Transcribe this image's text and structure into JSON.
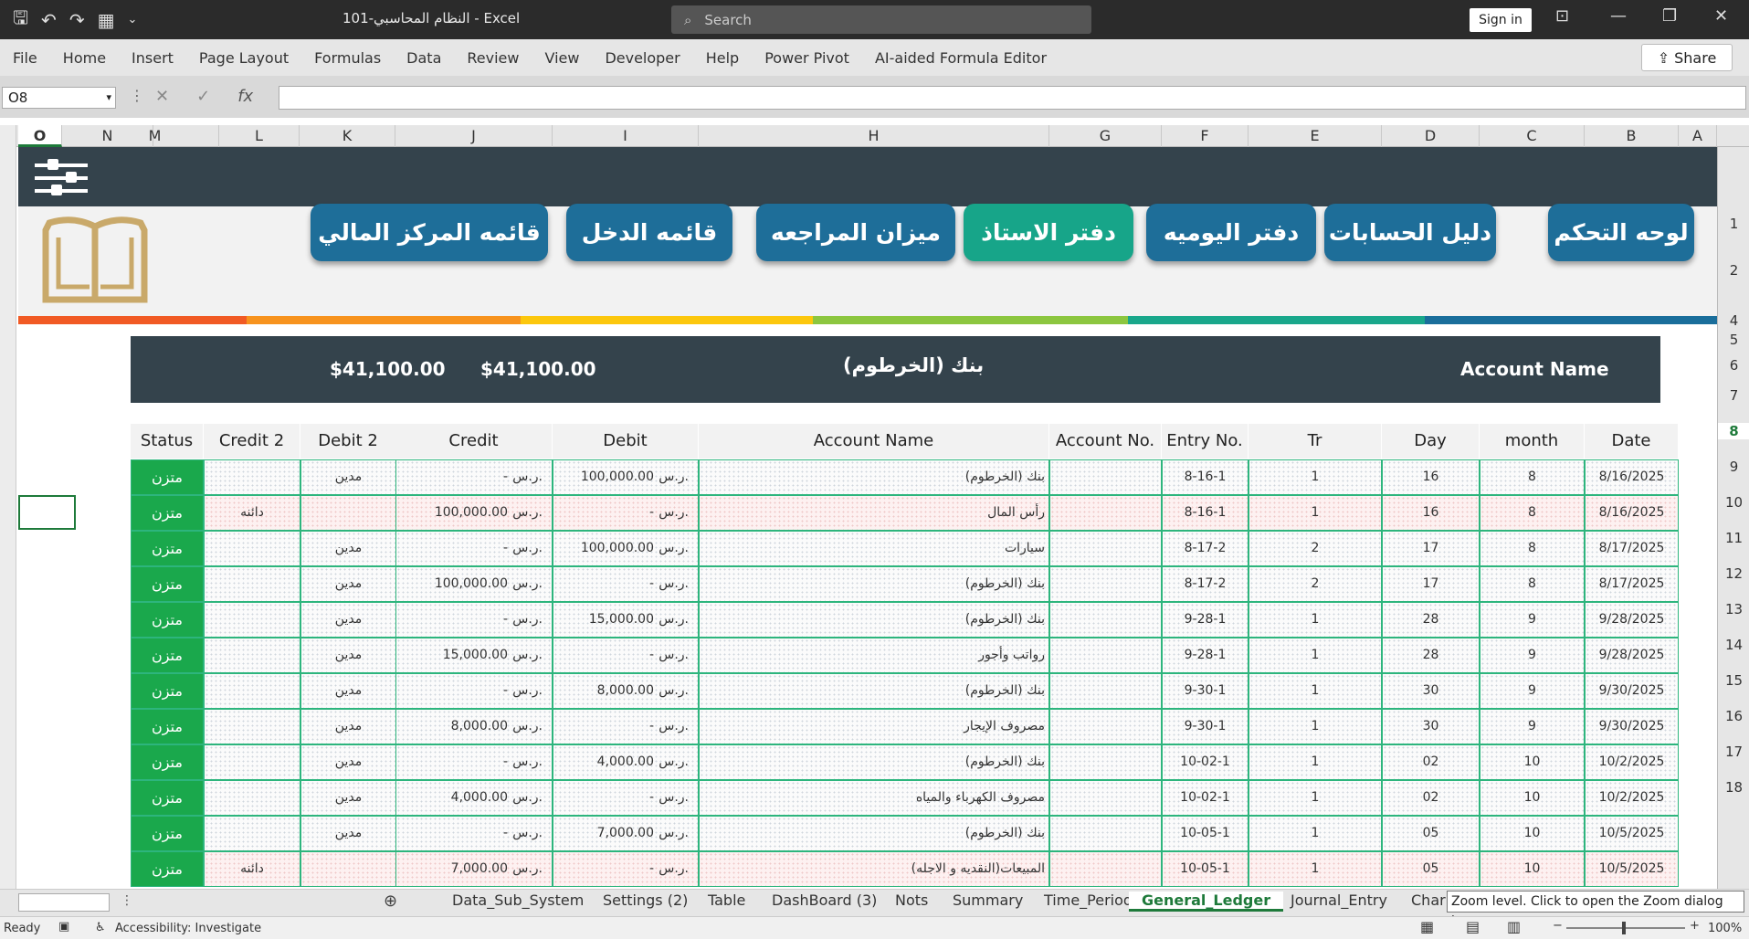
{
  "window": {
    "title": "النظام المحاسبي-101  -  Excel",
    "search_placeholder": "Search",
    "signin": "Sign in",
    "share": "Share"
  },
  "quick_access": {
    "icons": [
      "save-icon",
      "undo-icon",
      "redo-icon",
      "form-icon",
      "customize-icon"
    ]
  },
  "menu": [
    "File",
    "Home",
    "Insert",
    "Page Layout",
    "Formulas",
    "Data",
    "Review",
    "View",
    "Developer",
    "Help",
    "Power Pivot",
    "AI-aided Formula Editor"
  ],
  "formula_bar": {
    "name_box": "O8",
    "fx": "fx",
    "formula": ""
  },
  "columns": [
    "O",
    "N",
    "M",
    "L",
    "K",
    "J",
    "I",
    "H",
    "G",
    "F",
    "E",
    "D",
    "C",
    "B",
    "A"
  ],
  "row_headers": [
    "1",
    "2",
    "4",
    "5",
    "6",
    "7",
    "8",
    "9",
    "10",
    "11",
    "12",
    "13",
    "14",
    "15",
    "16",
    "17",
    "18"
  ],
  "nav_buttons": [
    {
      "label": "لوحه التحكم",
      "active": false
    },
    {
      "label": "دليل الحسابات",
      "active": false
    },
    {
      "label": "دفتر اليوميه",
      "active": false
    },
    {
      "label": "دفتر الاستاذ",
      "active": true
    },
    {
      "label": "ميزان المراجعه",
      "active": false
    },
    {
      "label": "قائمه الدخل",
      "active": false
    },
    {
      "label": "قائمه المركز المالي",
      "active": false
    }
  ],
  "stripe_colors": [
    "#f15a24",
    "#f7931e",
    "#fcc70d",
    "#8cc63f",
    "#19a78b",
    "#1a6e9b",
    "#1581c5"
  ],
  "account": {
    "label": "Account Name",
    "name": "بنك (الخرطوم)",
    "debit_total": "$41,100.00",
    "credit_total": "$41,100.00"
  },
  "table": {
    "headers": [
      "Status",
      "Credit 2",
      "Debit 2",
      "Credit",
      "Debit",
      "Account Name",
      "Account No.",
      "Entry No.",
      "Tr",
      "Day",
      "month",
      "Date"
    ],
    "rows": [
      {
        "status": "متزن",
        "credit2": "",
        "debit2": "مدين",
        "credit": "-",
        "debit": "100,000.00",
        "account": "بنك (الخرطوم)",
        "acc_no": "",
        "entry": "8-16-1",
        "tr": "1",
        "day": "16",
        "month": "8",
        "date": "8/16/2025",
        "pink": false,
        "idx": "1"
      },
      {
        "status": "متزن",
        "credit2": "دائنه",
        "debit2": "",
        "credit": "100,000.00",
        "debit": "-",
        "account": "رأس المال",
        "acc_no": "",
        "entry": "8-16-1",
        "tr": "1",
        "day": "16",
        "month": "8",
        "date": "8/16/2025",
        "pink": true,
        "idx": "2"
      },
      {
        "status": "متزن",
        "credit2": "",
        "debit2": "مدين",
        "credit": "-",
        "debit": "100,000.00",
        "account": "سيارات",
        "acc_no": "",
        "entry": "8-17-2",
        "tr": "2",
        "day": "17",
        "month": "8",
        "date": "8/17/2025",
        "pink": false,
        "idx": "3"
      },
      {
        "status": "متزن",
        "credit2": "",
        "debit2": "مدين",
        "credit": "100,000.00",
        "debit": "-",
        "account": "بنك (الخرطوم)",
        "acc_no": "",
        "entry": "8-17-2",
        "tr": "2",
        "day": "17",
        "month": "8",
        "date": "8/17/2025",
        "pink": false,
        "idx": "4"
      },
      {
        "status": "متزن",
        "credit2": "",
        "debit2": "مدين",
        "credit": "-",
        "debit": "15,000.00",
        "account": "بنك (الخرطوم)",
        "acc_no": "",
        "entry": "9-28-1",
        "tr": "1",
        "day": "28",
        "month": "9",
        "date": "9/28/2025",
        "pink": false,
        "idx": "5"
      },
      {
        "status": "متزن",
        "credit2": "",
        "debit2": "مدين",
        "credit": "15,000.00",
        "debit": "-",
        "account": "رواتب وأجور",
        "acc_no": "",
        "entry": "9-28-1",
        "tr": "1",
        "day": "28",
        "month": "9",
        "date": "9/28/2025",
        "pink": false,
        "idx": "6"
      },
      {
        "status": "متزن",
        "credit2": "",
        "debit2": "مدين",
        "credit": "-",
        "debit": "8,000.00",
        "account": "بنك (الخرطوم)",
        "acc_no": "",
        "entry": "9-30-1",
        "tr": "1",
        "day": "30",
        "month": "9",
        "date": "9/30/2025",
        "pink": false,
        "idx": "7"
      },
      {
        "status": "متزن",
        "credit2": "",
        "debit2": "مدين",
        "credit": "8,000.00",
        "debit": "-",
        "account": "مصروف الإيجار",
        "acc_no": "",
        "entry": "9-30-1",
        "tr": "1",
        "day": "30",
        "month": "9",
        "date": "9/30/2025",
        "pink": false,
        "idx": "8"
      },
      {
        "status": "متزن",
        "credit2": "",
        "debit2": "مدين",
        "credit": "-",
        "debit": "4,000.00",
        "account": "بنك (الخرطوم)",
        "acc_no": "",
        "entry": "10-02-1",
        "tr": "1",
        "day": "02",
        "month": "10",
        "date": "10/2/2025",
        "pink": false,
        "idx": "9"
      },
      {
        "status": "متزن",
        "credit2": "",
        "debit2": "مدين",
        "credit": "4,000.00",
        "debit": "-",
        "account": "مصروف الكهرباء والمياه",
        "acc_no": "",
        "entry": "10-02-1",
        "tr": "1",
        "day": "02",
        "month": "10",
        "date": "10/2/2025",
        "pink": false,
        "idx": "10"
      },
      {
        "status": "متزن",
        "credit2": "",
        "debit2": "مدين",
        "credit": "-",
        "debit": "7,000.00",
        "account": "بنك (الخرطوم)",
        "acc_no": "",
        "entry": "10-05-1",
        "tr": "1",
        "day": "05",
        "month": "10",
        "date": "10/5/2025",
        "pink": false,
        "idx": "11"
      },
      {
        "status": "متزن",
        "credit2": "دائنه",
        "debit2": "",
        "credit": "7,000.00",
        "debit": "-",
        "account": "المبيعات(النقديه و الاجله)",
        "acc_no": "",
        "entry": "10-05-1",
        "tr": "1",
        "day": "05",
        "month": "10",
        "date": "10/5/2025",
        "pink": true,
        "idx": "12"
      }
    ],
    "currency": "ر.س."
  },
  "sheet_tabs": [
    "Data_Sub_System",
    "Settings (2)",
    "Table",
    "DashBoard (3)",
    "Nots",
    "Summary",
    "Time_Period",
    "General_Ledger",
    "Journal_Entry",
    "Char"
  ],
  "active_tab": "General_Ledger",
  "tooltip": "Zoom level. Click to open the Zoom dialog box.",
  "status_bar": {
    "ready": "Ready",
    "accessibility": "Accessibility: Investigate",
    "zoom": "100%"
  }
}
